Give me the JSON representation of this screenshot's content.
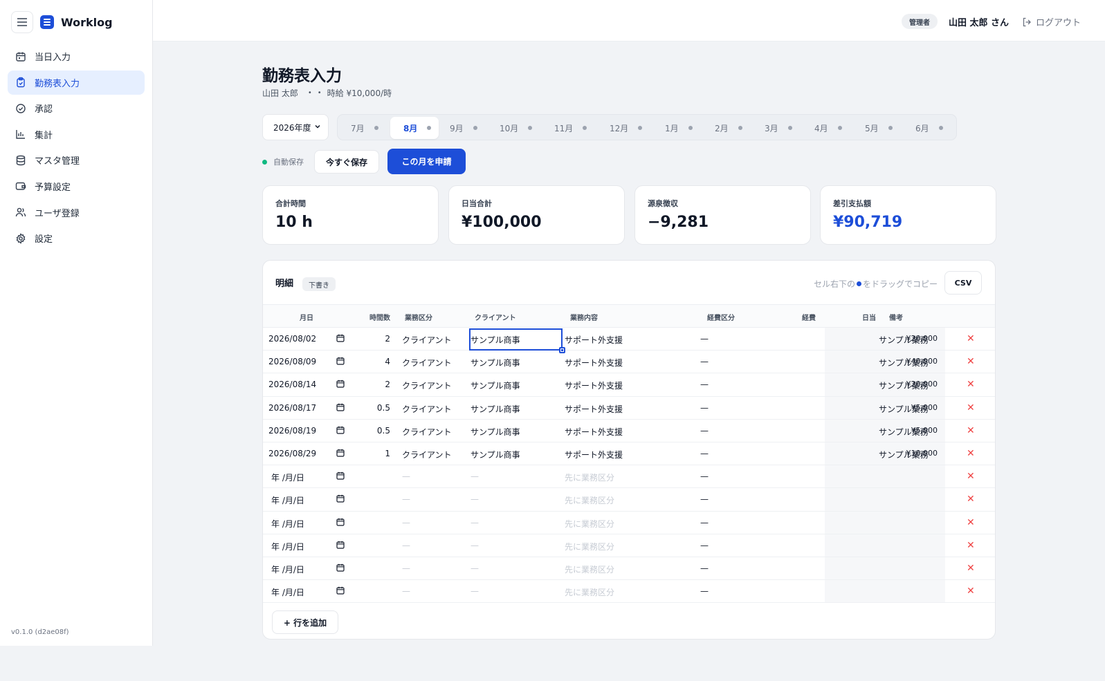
{
  "app": {
    "name": "Worklog",
    "version": "v0.1.0 (d2ae08f)"
  },
  "sidebar": {
    "items": [
      {
        "label": "当日入力",
        "icon": "calendar-icon"
      },
      {
        "label": "勤務表入力",
        "icon": "clipboard-icon",
        "active": true
      },
      {
        "label": "承認",
        "icon": "check-circle-icon"
      },
      {
        "label": "集計",
        "icon": "bar-chart-icon"
      },
      {
        "label": "マスタ管理",
        "icon": "database-icon"
      },
      {
        "label": "予算設定",
        "icon": "wallet-icon"
      },
      {
        "label": "ユーザ登録",
        "icon": "users-icon"
      },
      {
        "label": "設定",
        "icon": "gear-icon"
      }
    ]
  },
  "header": {
    "role": "管理者",
    "user": "山田 太郎 さん",
    "logout": "ログアウト"
  },
  "page": {
    "title": "勤務表入力",
    "subtitle_name": "山田 太郎",
    "subtitle_rate": "時給 ¥10,000/時",
    "fiscal_year": "2026年度",
    "months": [
      "7月",
      "8月",
      "9月",
      "10月",
      "11月",
      "12月",
      "1月",
      "2月",
      "3月",
      "4月",
      "5月",
      "6月"
    ],
    "active_month": "8月",
    "autosave": "自動保存",
    "save_now": "今すぐ保存",
    "apply": "この月を申請"
  },
  "summary": {
    "total_hours": {
      "label": "合計時間",
      "value": "10 h"
    },
    "daily_total": {
      "label": "日当合計",
      "value": "¥100,000"
    },
    "withholding": {
      "label": "源泉徴収",
      "value": "−9,281"
    },
    "net_pay": {
      "label": "差引支払額",
      "value": "¥90,719"
    }
  },
  "details": {
    "title": "明細",
    "status": "下書き",
    "hint_before": "セル右下の",
    "hint_after": "をドラッグでコピー",
    "csv": "CSV",
    "columns": [
      "月日",
      "時間数",
      "業務区分",
      "クライアント",
      "業務内容",
      "経費区分",
      "経費",
      "日当",
      "備考"
    ],
    "rows": [
      {
        "date": "2026/08/02",
        "hours": "2",
        "category": "クライアント",
        "client": "サンプル商事",
        "work": "サポート外支援",
        "expense_type": "—",
        "expense": "",
        "daily": "¥20,000",
        "note": "サンプル業務"
      },
      {
        "date": "2026/08/09",
        "hours": "4",
        "category": "クライアント",
        "client": "サンプル商事",
        "work": "サポート外支援",
        "expense_type": "—",
        "expense": "",
        "daily": "¥40,000",
        "note": "サンプル業務"
      },
      {
        "date": "2026/08/14",
        "hours": "2",
        "category": "クライアント",
        "client": "サンプル商事",
        "work": "サポート外支援",
        "expense_type": "—",
        "expense": "",
        "daily": "¥20,000",
        "note": "サンプル業務"
      },
      {
        "date": "2026/08/17",
        "hours": "0.5",
        "category": "クライアント",
        "client": "サンプル商事",
        "work": "サポート外支援",
        "expense_type": "—",
        "expense": "",
        "daily": "¥5,000",
        "note": "サンプル業務"
      },
      {
        "date": "2026/08/19",
        "hours": "0.5",
        "category": "クライアント",
        "client": "サンプル商事",
        "work": "サポート外支援",
        "expense_type": "—",
        "expense": "",
        "daily": "¥5,000",
        "note": "サンプル業務"
      },
      {
        "date": "2026/08/29",
        "hours": "1",
        "category": "クライアント",
        "client": "サンプル商事",
        "work": "サポート外支援",
        "expense_type": "—",
        "expense": "",
        "daily": "¥10,000",
        "note": "サンプル業務"
      },
      {
        "date": "年 /月/日",
        "hours": "",
        "category": "—",
        "client": "—",
        "work": "先に業務区分",
        "expense_type": "—",
        "expense": "",
        "daily": "",
        "note": "",
        "empty": true
      },
      {
        "date": "年 /月/日",
        "hours": "",
        "category": "—",
        "client": "—",
        "work": "先に業務区分",
        "expense_type": "—",
        "expense": "",
        "daily": "",
        "note": "",
        "empty": true
      },
      {
        "date": "年 /月/日",
        "hours": "",
        "category": "—",
        "client": "—",
        "work": "先に業務区分",
        "expense_type": "—",
        "expense": "",
        "daily": "",
        "note": "",
        "empty": true
      },
      {
        "date": "年 /月/日",
        "hours": "",
        "category": "—",
        "client": "—",
        "work": "先に業務区分",
        "expense_type": "—",
        "expense": "",
        "daily": "",
        "note": "",
        "empty": true
      },
      {
        "date": "年 /月/日",
        "hours": "",
        "category": "—",
        "client": "—",
        "work": "先に業務区分",
        "expense_type": "—",
        "expense": "",
        "daily": "",
        "note": "",
        "empty": true
      },
      {
        "date": "年 /月/日",
        "hours": "",
        "category": "—",
        "client": "—",
        "work": "先に業務区分",
        "expense_type": "—",
        "expense": "",
        "daily": "",
        "note": "",
        "empty": true
      }
    ],
    "add_row": "+ 行を追加"
  },
  "colors": {
    "accent": "#1d4ed8",
    "danger": "#ef4444",
    "success": "#10b981"
  }
}
